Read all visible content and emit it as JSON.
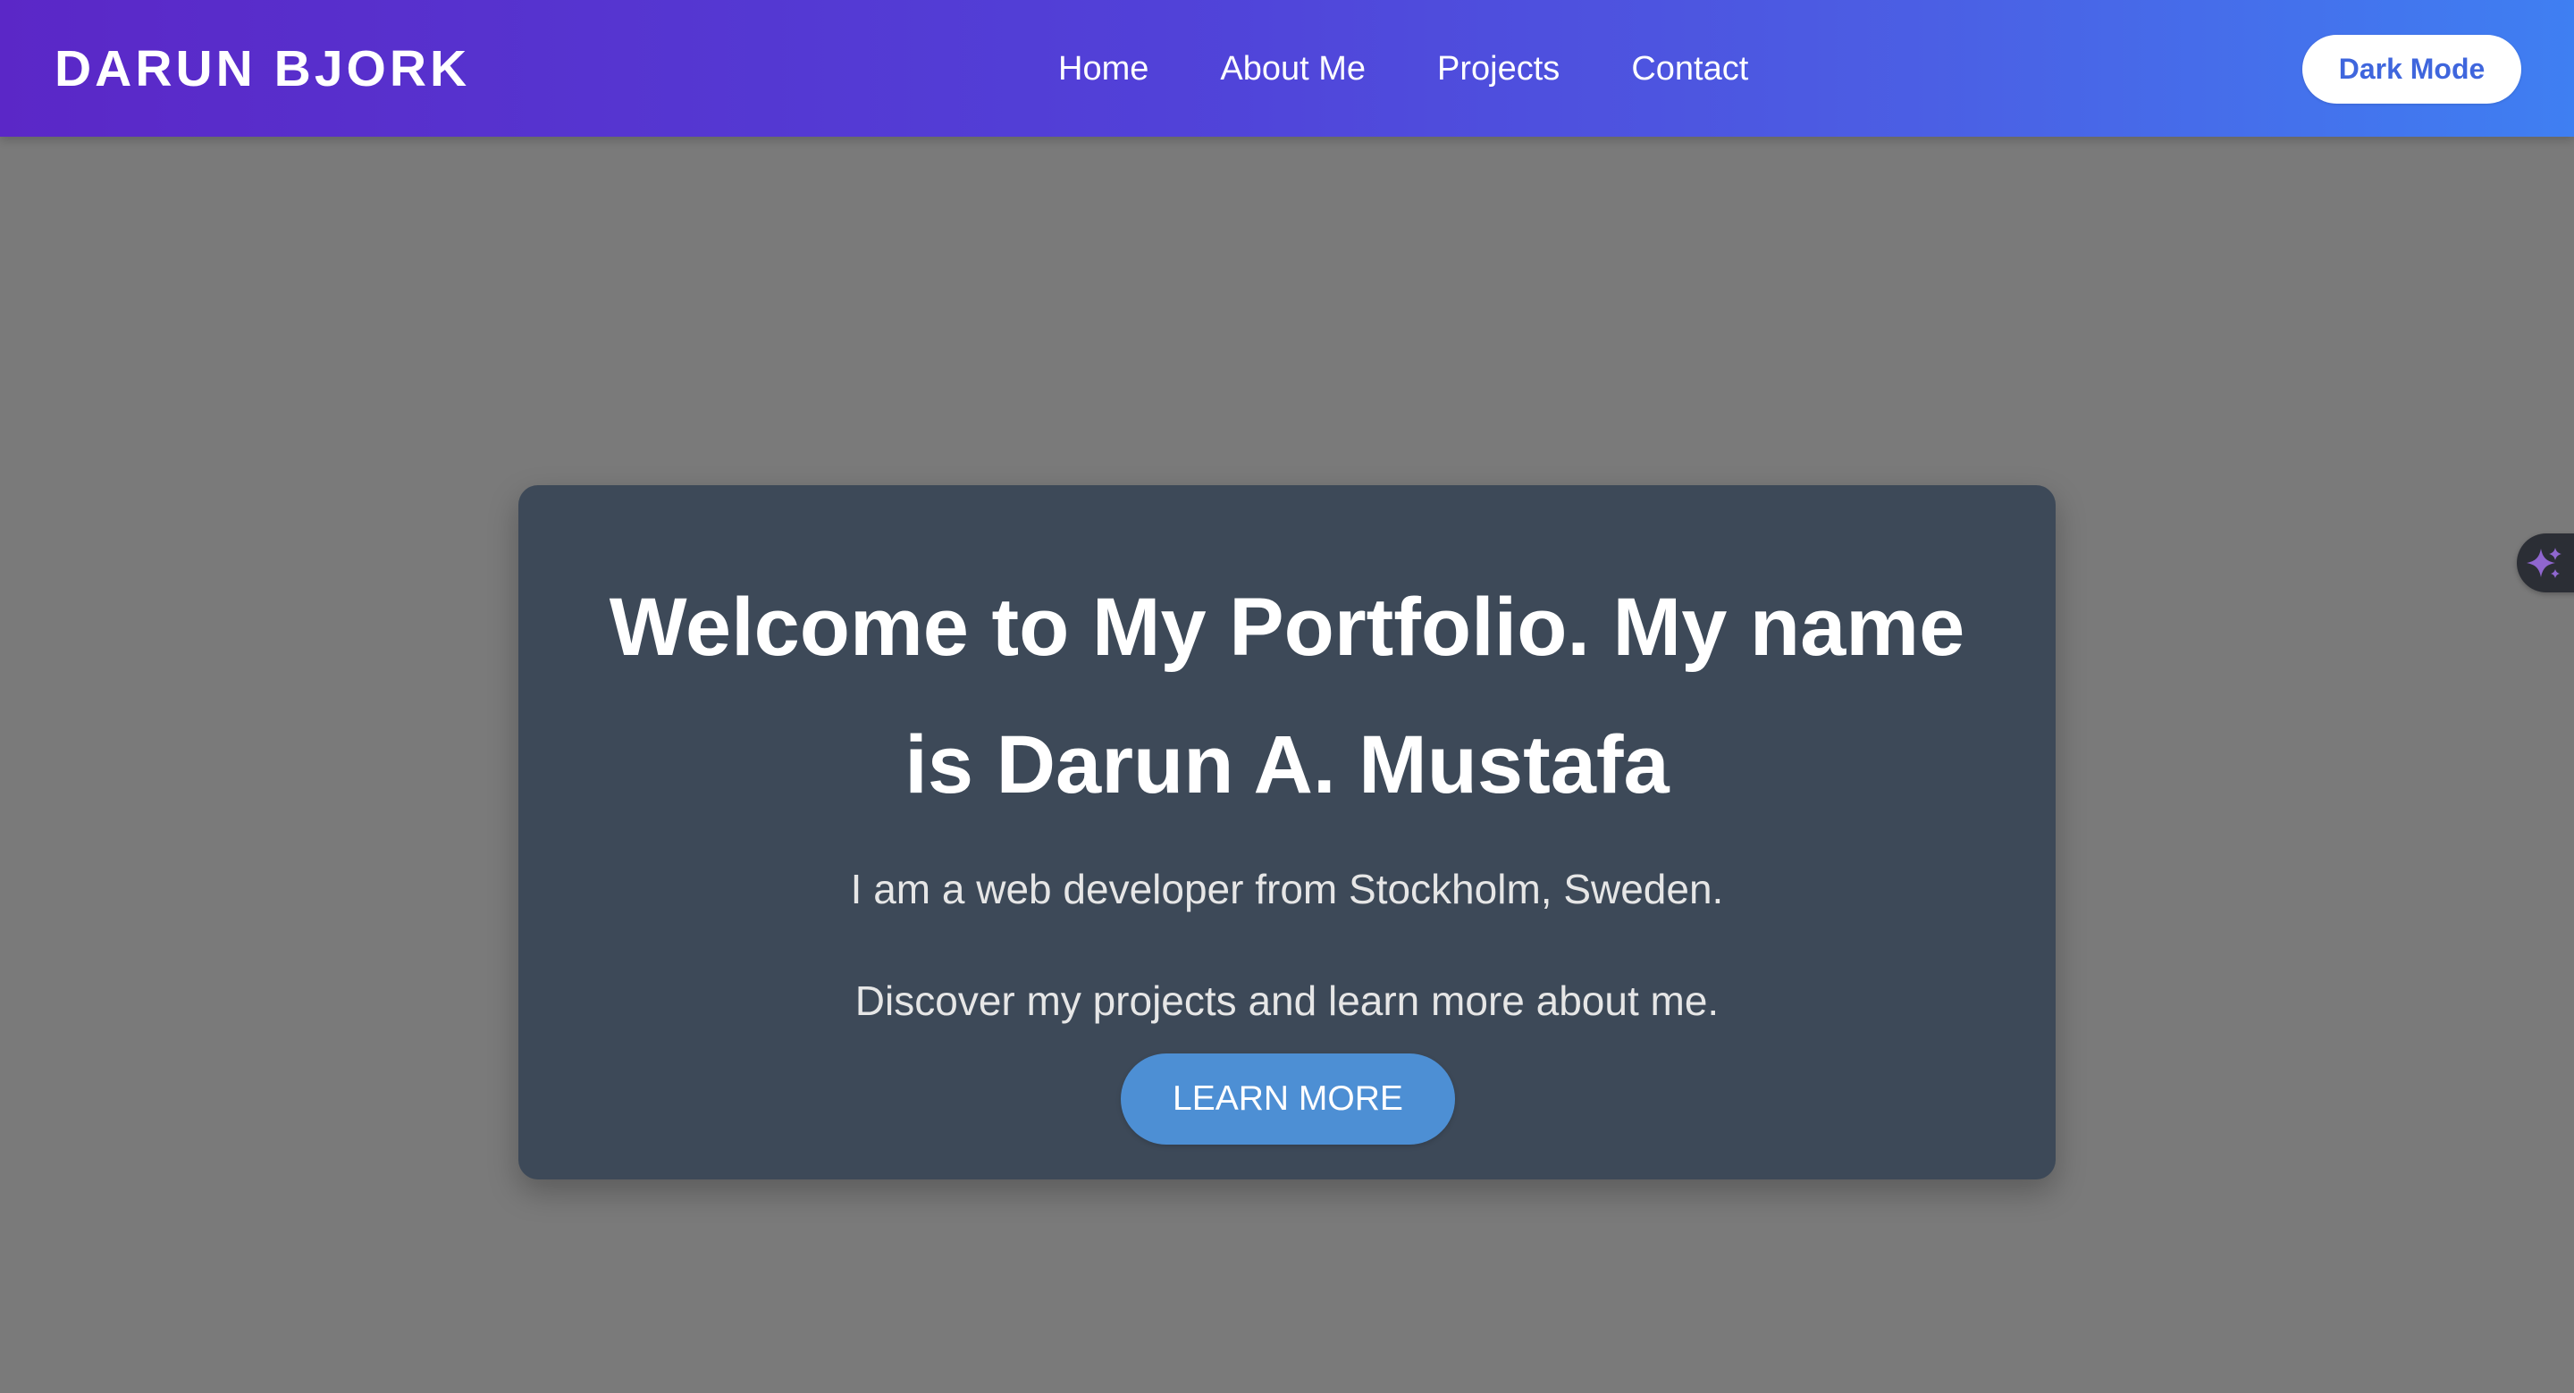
{
  "header": {
    "brand": "DARUN BJORK",
    "nav": [
      {
        "label": "Home"
      },
      {
        "label": "About Me"
      },
      {
        "label": "Projects"
      },
      {
        "label": "Contact"
      }
    ],
    "mode_button_label": "Dark Mode"
  },
  "hero": {
    "title": "Welcome to My Portfolio. My name is Darun A. Mustafa",
    "subtitle": "I am a web developer from Stockholm, Sweden.",
    "description": "Discover my projects and learn more about me.",
    "cta_label": "LEARN MORE"
  },
  "floating_tab": {
    "icon": "sparkle-icon"
  },
  "colors": {
    "page_background": "#7a7a7a",
    "header_gradient_start": "#5b27c7",
    "header_gradient_end": "#3f7ff2",
    "hero_card": "#3d4958",
    "cta_button": "#4d8fd4",
    "mode_button_text": "#3f66dd"
  }
}
